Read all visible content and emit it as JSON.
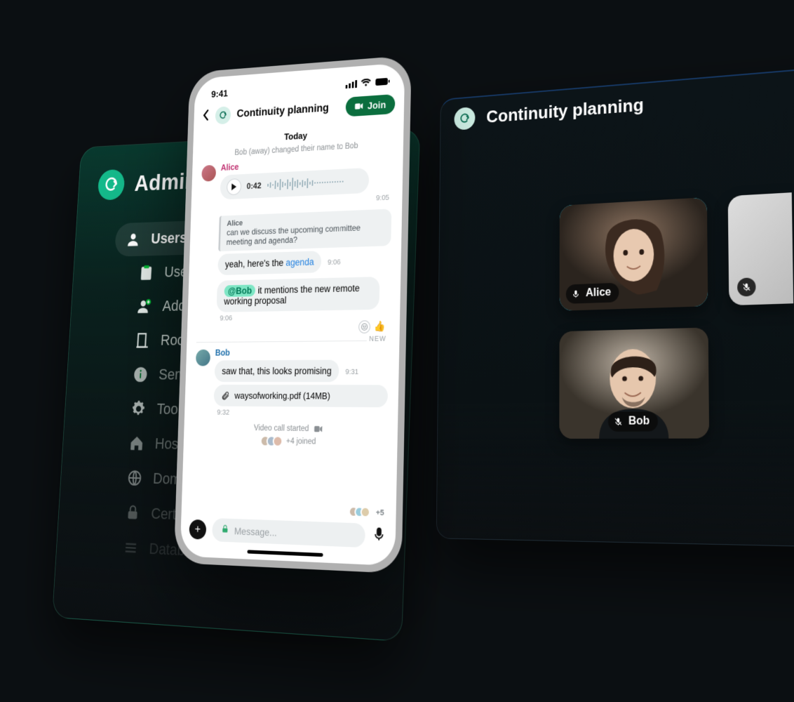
{
  "admin": {
    "title": "Admin Cons",
    "items": [
      {
        "id": "users",
        "label": "Users",
        "selected": true
      },
      {
        "id": "user-info",
        "label": "User info"
      },
      {
        "id": "add-user",
        "label": "Add user"
      },
      {
        "id": "rooms",
        "label": "Rooms"
      },
      {
        "id": "server-info",
        "label": "Server info"
      },
      {
        "id": "tools",
        "label": "Tools"
      },
      {
        "id": "host",
        "label": "Host"
      },
      {
        "id": "domains",
        "label": "Domains"
      },
      {
        "id": "certificates",
        "label": "Certificates"
      },
      {
        "id": "database",
        "label": "Database"
      }
    ]
  },
  "desktop": {
    "title": "Continuity planning",
    "participants": {
      "alice": "Alice",
      "bob": "Bob"
    }
  },
  "phone": {
    "status_time": "9:41",
    "title": "Continuity planning",
    "join_label": "Join",
    "day_label": "Today",
    "system_event": "Bob (away) changed their name to Bob",
    "alice_name": "Alice",
    "bob_name": "Bob",
    "voice_duration": "0:42",
    "voice_ts": "9:05",
    "quote_author": "Alice",
    "quote_text": "can we discuss the upcoming committee meeting and agenda?",
    "msg1_prefix": "yeah, here's the ",
    "msg1_link": "agenda",
    "msg1_ts": "9:06",
    "msg2_mention": "@Bob",
    "msg2_text": " it mentions the new remote working proposal",
    "msg2_ts": "9:06",
    "reaction_emoji": "👍",
    "new_label": "NEW",
    "bob_msg": "saw that, this looks promising",
    "bob_msg_ts": "9:31",
    "attachment_name": "waysofworking.pdf  (14MB)",
    "attachment_ts": "9:32",
    "vc_started": "Video call started",
    "vc_joined": "+4 joined",
    "typing_count": "+5",
    "composer_placeholder": "Message..."
  }
}
